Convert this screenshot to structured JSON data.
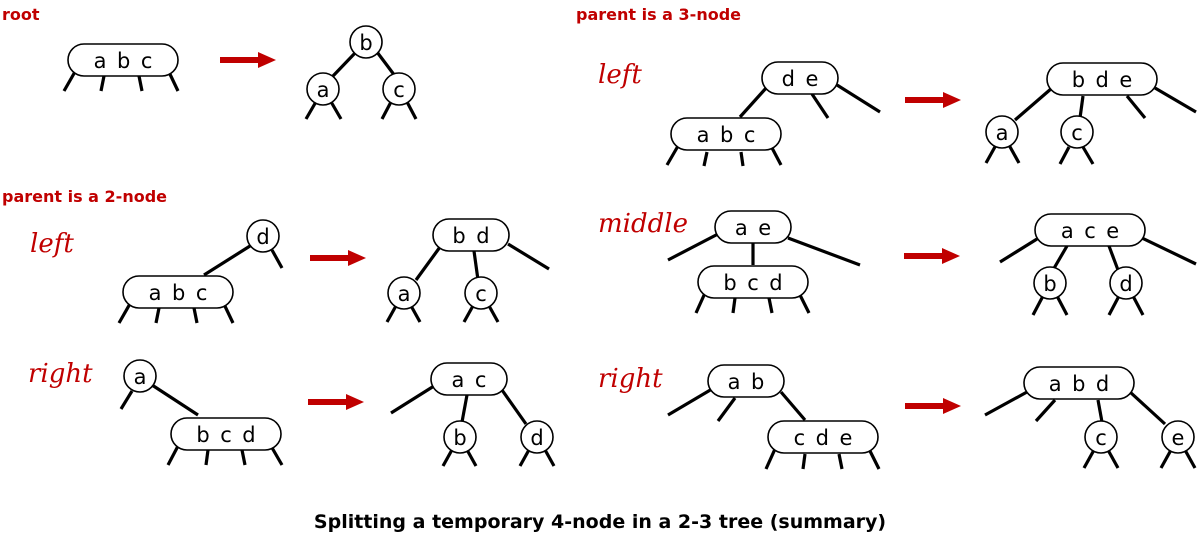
{
  "caption": "Splitting a temporary 4-node in a 2-3 tree (summary)",
  "colors": {
    "accent": "#c00000",
    "ink": "#000000"
  },
  "sections": {
    "root": {
      "title": "root"
    },
    "parent2": {
      "title": "parent is a 2-node",
      "cases": {
        "left": "left",
        "right": "right"
      }
    },
    "parent3": {
      "title": "parent is a 3-node",
      "cases": {
        "left": "left",
        "middle": "middle",
        "right": "right"
      }
    }
  },
  "trees": {
    "root_before": {
      "nodes": [
        "a b c"
      ]
    },
    "root_after": {
      "nodes": [
        "b",
        "a",
        "c"
      ]
    },
    "p2_left_before": {
      "nodes": [
        "d",
        "a b c"
      ]
    },
    "p2_left_after": {
      "nodes": [
        "b d",
        "a",
        "c"
      ]
    },
    "p2_right_before": {
      "nodes": [
        "a",
        "b c d"
      ]
    },
    "p2_right_after": {
      "nodes": [
        "a c",
        "b",
        "d"
      ]
    },
    "p3_left_before": {
      "nodes": [
        "d e",
        "a b c"
      ]
    },
    "p3_left_after": {
      "nodes": [
        "b d e",
        "a",
        "c"
      ]
    },
    "p3_middle_before": {
      "nodes": [
        "a e",
        "b c d"
      ]
    },
    "p3_middle_after": {
      "nodes": [
        "a c e",
        "b",
        "d"
      ]
    },
    "p3_right_before": {
      "nodes": [
        "a b",
        "c d e"
      ]
    },
    "p3_right_after": {
      "nodes": [
        "a b d",
        "c",
        "e"
      ]
    }
  },
  "icons": {
    "transform_arrow": "right-arrow-icon"
  }
}
